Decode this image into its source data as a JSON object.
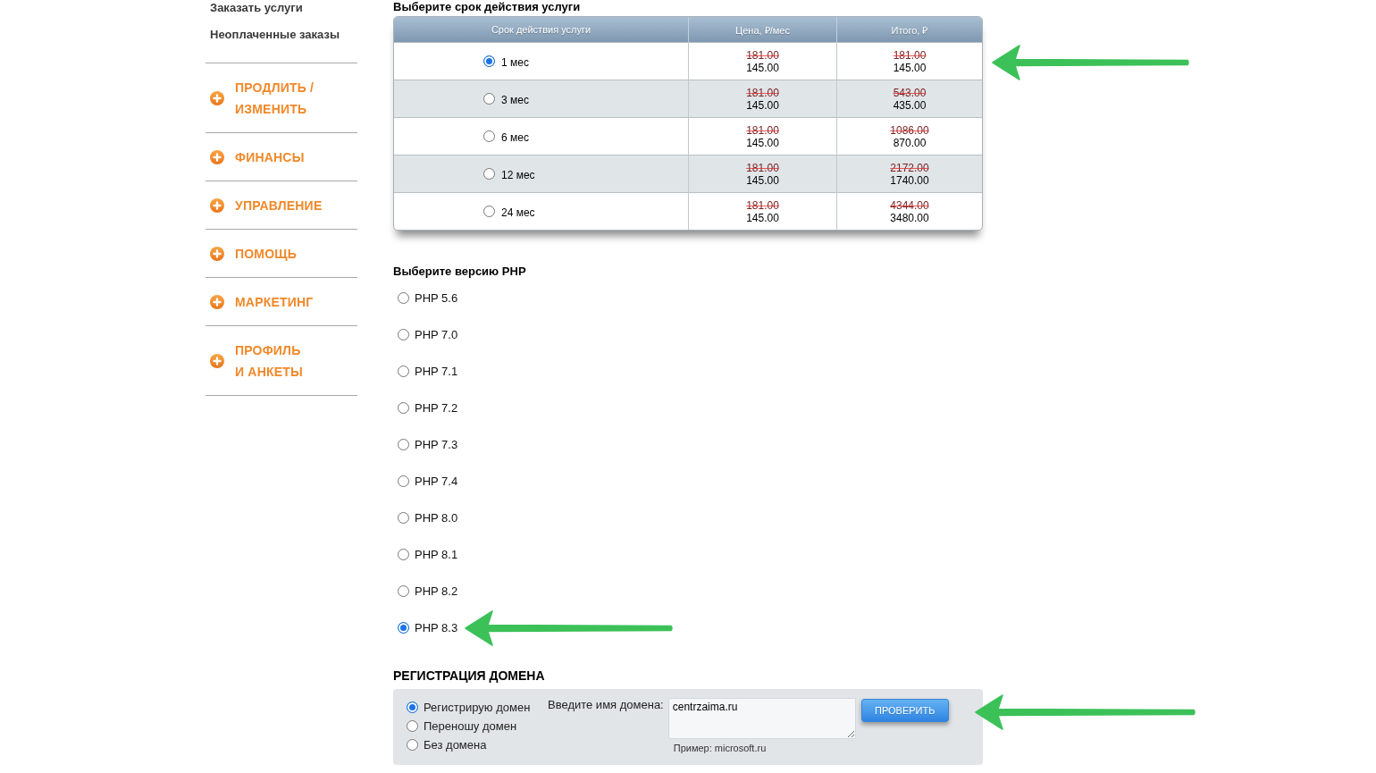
{
  "sidebar": {
    "links": [
      {
        "label": "Заказать услуги"
      },
      {
        "label": "Неоплаченные заказы"
      }
    ],
    "menu": [
      {
        "label": "ПРОДЛИТЬ /\nИЗМЕНИТЬ"
      },
      {
        "label": "ФИНАНСЫ"
      },
      {
        "label": "УПРАВЛЕНИЕ"
      },
      {
        "label": "ПОМОЩЬ"
      },
      {
        "label": "МАРКЕТИНГ"
      },
      {
        "label": "ПРОФИЛЬ\nИ АНКЕТЫ"
      }
    ]
  },
  "term_table": {
    "title": "Выберите срок действия услуги",
    "columns": [
      "Срок действия услуги",
      "Цена, ₽/мес",
      "Итого, ₽"
    ],
    "rows": [
      {
        "label": "1 мес",
        "selected": true,
        "old_price": "181.00",
        "price": "145.00",
        "old_total": "181.00",
        "total": "145.00"
      },
      {
        "label": "3 мес",
        "selected": false,
        "old_price": "181.00",
        "price": "145.00",
        "old_total": "543.00",
        "total": "435.00"
      },
      {
        "label": "6 мес",
        "selected": false,
        "old_price": "181.00",
        "price": "145.00",
        "old_total": "1086.00",
        "total": "870.00"
      },
      {
        "label": "12 мес",
        "selected": false,
        "old_price": "181.00",
        "price": "145.00",
        "old_total": "2172.00",
        "total": "1740.00"
      },
      {
        "label": "24 мес",
        "selected": false,
        "old_price": "181.00",
        "price": "145.00",
        "old_total": "4344.00",
        "total": "3480.00"
      }
    ]
  },
  "php": {
    "title": "Выберите версию PHP",
    "options": [
      {
        "label": "PHP 5.6",
        "selected": false
      },
      {
        "label": "PHP 7.0",
        "selected": false
      },
      {
        "label": "PHP 7.1",
        "selected": false
      },
      {
        "label": "PHP 7.2",
        "selected": false
      },
      {
        "label": "PHP 7.3",
        "selected": false
      },
      {
        "label": "PHP 7.4",
        "selected": false
      },
      {
        "label": "PHP 8.0",
        "selected": false
      },
      {
        "label": "PHP 8.1",
        "selected": false
      },
      {
        "label": "PHP 8.2",
        "selected": false
      },
      {
        "label": "PHP 8.3",
        "selected": true
      }
    ]
  },
  "domain": {
    "title": "РЕГИСТРАЦИЯ ДОМЕНА",
    "options": [
      {
        "label": "Регистрирую домен",
        "selected": true
      },
      {
        "label": "Переношу домен",
        "selected": false
      },
      {
        "label": "Без домена",
        "selected": false
      }
    ],
    "field_label": "Введите имя домена:",
    "value": "centrzaima.ru",
    "hint": "Пример: microsoft.ru",
    "button": "ПРОВЕРИТЬ"
  }
}
